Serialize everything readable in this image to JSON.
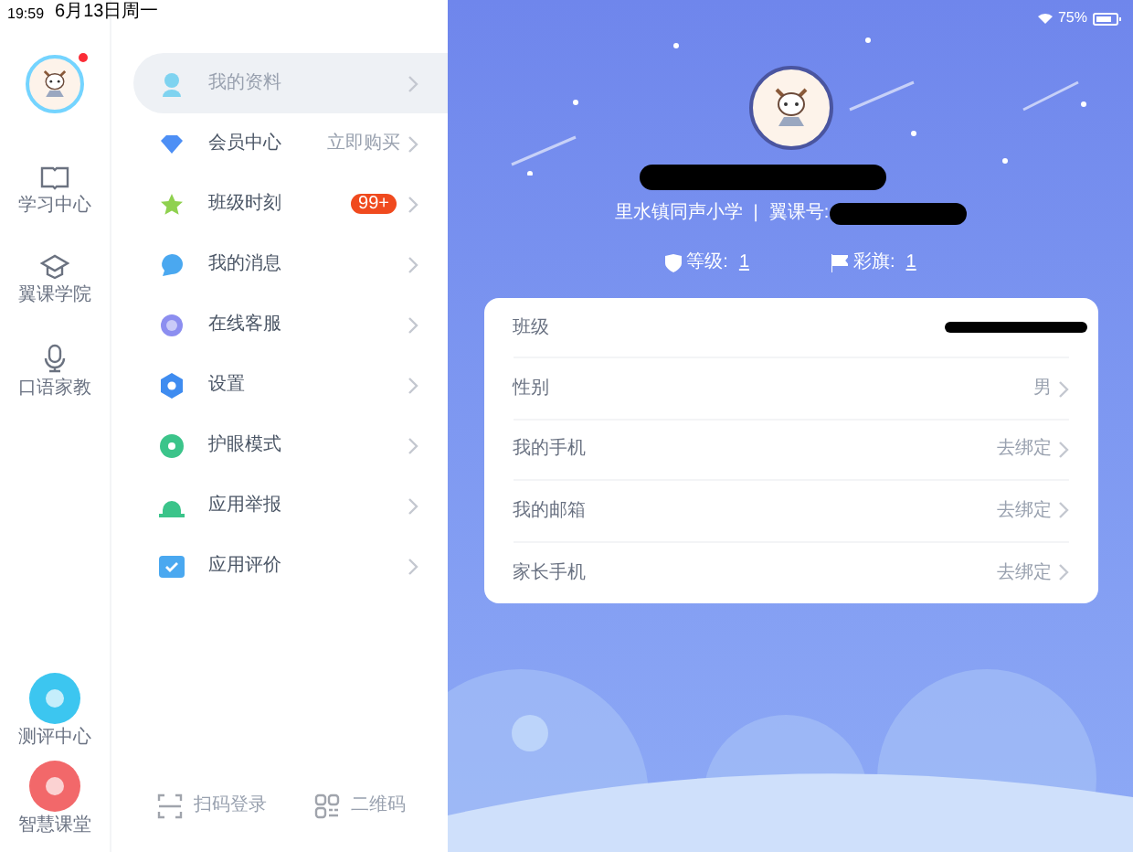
{
  "status_bar": {
    "time": "19:59",
    "date": "6月13日周一",
    "battery": "75%"
  },
  "rail": {
    "avatar_notification": true,
    "items": [
      {
        "label": "学习中心"
      },
      {
        "label": "翼课学院"
      },
      {
        "label": "口语家教"
      }
    ],
    "bottom": [
      {
        "label": "测评中心",
        "color": "#3cc6f0"
      },
      {
        "label": "智慧课堂",
        "color": "#f2686a"
      }
    ]
  },
  "menu": {
    "items": [
      {
        "label": "我的资料",
        "selected": true
      },
      {
        "label": "会员中心",
        "selected": false,
        "hint": "立即购买"
      },
      {
        "label": "班级时刻",
        "selected": false,
        "badge": "99+"
      },
      {
        "label": "我的消息",
        "selected": false
      },
      {
        "label": "在线客服",
        "selected": false
      },
      {
        "label": "设置",
        "selected": false
      },
      {
        "label": "护眼模式",
        "selected": false
      },
      {
        "label": "应用举报",
        "selected": false
      },
      {
        "label": "应用评价",
        "selected": false
      }
    ],
    "footer": [
      {
        "label": "扫码登录"
      },
      {
        "label": "二维码"
      }
    ]
  },
  "profile": {
    "school": "里水镇同声小学",
    "separator": "|",
    "id_label": "翼课号:",
    "stats": [
      {
        "label": "等级:",
        "value": "1"
      },
      {
        "label": "彩旗:",
        "value": "1"
      }
    ]
  },
  "details": [
    {
      "label": "班级"
    },
    {
      "label": "性别",
      "value": "男"
    },
    {
      "label": "我的手机",
      "value": "去绑定"
    },
    {
      "label": "我的邮箱",
      "value": "去绑定"
    },
    {
      "label": "家长手机",
      "value": "去绑定"
    }
  ]
}
